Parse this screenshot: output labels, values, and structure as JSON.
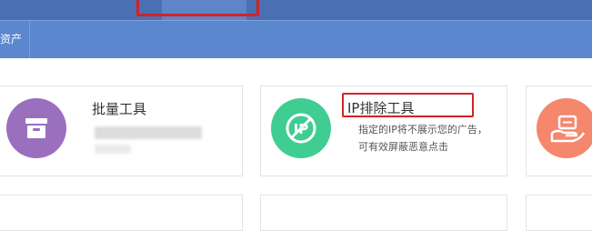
{
  "subnav": {
    "item_label": "资产"
  },
  "cards": [
    {
      "title": "批量工具",
      "icon": "archive-box-icon",
      "color": "#9a6fbe"
    },
    {
      "title": "IP排除工具",
      "desc_line1": "指定的IP将不展示您的广告，",
      "desc_line2": "可有效屏蔽恶意点击",
      "icon": "ip-blocked-icon",
      "color": "#3fcd92"
    },
    {
      "title": "",
      "icon": "hand-money-icon",
      "color": "#f4876c"
    }
  ],
  "colors": {
    "topbar": "#4a70b3",
    "subbar": "#5b87cf",
    "annotation": "#d0232a"
  }
}
